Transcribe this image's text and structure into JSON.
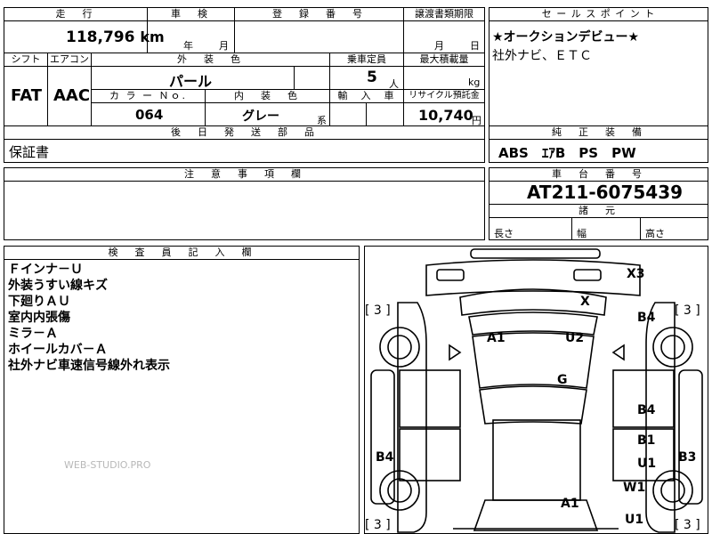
{
  "top_table": {
    "headers": {
      "mileage": "走　行",
      "inspection": "車　検",
      "registration": "登　録　番　号",
      "transfer_deadline": "譲渡書類期限",
      "sales_point": "セ ー ル ス ポ イ ン ト"
    },
    "mileage_value": "118,796",
    "mileage_unit": "km",
    "inspection_year_unit": "年",
    "inspection_month_unit": "月",
    "transfer_month_unit": "月",
    "transfer_day_unit": "日",
    "row2_headers": {
      "shift": "シフト",
      "aircon": "エアコン",
      "exterior_color": "外　装　色",
      "capacity": "乗車定員",
      "max_load": "最大積載量"
    },
    "shift_value": "FAT",
    "aircon_value": "AAC",
    "exterior_color_value": "パール",
    "capacity_value": "5",
    "capacity_unit": "人",
    "max_load_unit": "kg",
    "row3_headers": {
      "color_no": "カ ラ ー Ｎｏ.",
      "interior_color": "内　装　色",
      "import": "輸　入　車",
      "recycle_fee": "リサイクル預託金"
    },
    "color_no_value": "064",
    "interior_color_value": "グレー",
    "interior_color_suffix": "系",
    "recycle_fee_value": "10,740",
    "recycle_fee_unit": "円",
    "later_parts_header": "後　日　発　送　部　品",
    "later_parts_value": "保証書"
  },
  "sales_points": {
    "lines": [
      "★オークションデビュー★",
      "社外ナビ、ＥＴＣ"
    ]
  },
  "equipment": {
    "header": "純　正　装　備",
    "value": "ABS　ｴｱB　PS　PW"
  },
  "notes": {
    "header": "注　意　事　項　欄"
  },
  "chassis": {
    "header": "車　台　番　号",
    "value": "AT211-6075439"
  },
  "dimensions": {
    "header": "諸　元",
    "length": "長さ",
    "width": "幅",
    "height": "高さ"
  },
  "inspector": {
    "header": "検　査　員　記　入　欄",
    "lines": [
      "Ｆインナ－Ｕ",
      "外装うすい線キズ",
      "下廻りＡＵ",
      "室内内張傷",
      "ミラ－Ａ",
      "ホイールカバ－Ａ",
      "社外ナビ車速信号線外れ表示"
    ]
  },
  "diagram": {
    "labels": {
      "x3": "X3",
      "x": "X",
      "a1_front": "A1",
      "u2": "U2",
      "b4_front_right": "B4",
      "g": "G",
      "b4_mid_right": "B4",
      "b1": "B1",
      "u1_mid": "U1",
      "b4_left": "B4",
      "b3": "B3",
      "w1": "W1",
      "a1_rear": "A1",
      "u1_rear": "U1"
    },
    "tread_left_top": "[ 3 ]",
    "tread_right_top": "[ 3 ]",
    "tread_left_bottom": "[ 3 ]",
    "tread_right_bottom": "[ 3 ]"
  },
  "watermark": "WEB-STUDIO.PRO"
}
